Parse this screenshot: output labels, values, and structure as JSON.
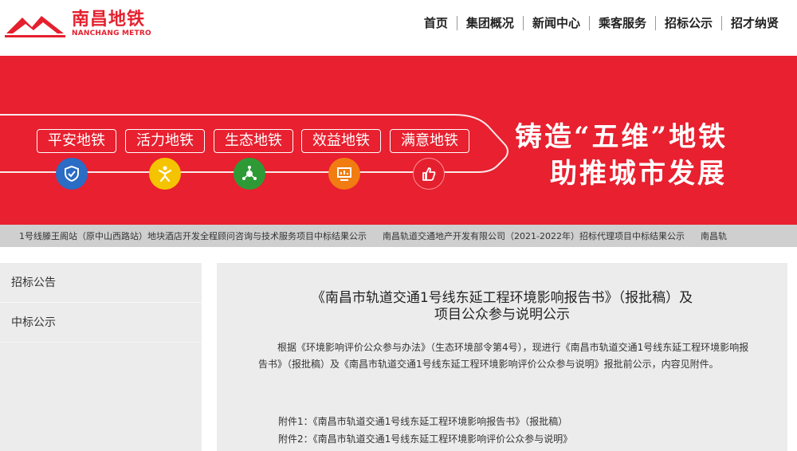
{
  "header": {
    "logo_cn": "南昌地铁",
    "logo_en": "NANCHANG METRO",
    "nav": [
      "首页",
      "集团概况",
      "新闻中心",
      "乘客服务",
      "招标公示",
      "招才纳贤"
    ]
  },
  "banner": {
    "pills": [
      "平安地铁",
      "活力地铁",
      "生态地铁",
      "效益地铁",
      "满意地铁"
    ],
    "icons": [
      {
        "name": "shield-check-icon",
        "color": "#2b6cc4"
      },
      {
        "name": "person-vitality-icon",
        "color": "#f5c400"
      },
      {
        "name": "eco-network-icon",
        "color": "#2e9a36"
      },
      {
        "name": "monitor-chart-icon",
        "color": "#f07c12"
      },
      {
        "name": "thumbs-up-icon",
        "color": "#e5202e"
      }
    ],
    "slogan_line1": "铸造“五维”地铁",
    "slogan_line2": "助推城市发展"
  },
  "ticker": [
    "1号线滕王阁站（原中山西路站）地块酒店开发全程顾问咨询与技术服务项目中标结果公示",
    "南昌轨道交通地产开发有限公司（2021-2022年）招标代理项目中标结果公示",
    "南昌轨"
  ],
  "sidebar": [
    "招标公告",
    "中标公示"
  ],
  "article": {
    "title_line1": "《南昌市轨道交通1号线东延工程环境影响报告书》（报批稿）及",
    "title_line2": "项目公众参与说明公示",
    "paragraph": "根据《环境影响评价公众参与办法》（生态环境部令第4号），现进行《南昌市轨道交通1号线东延工程环境影响报告书》（报批稿）及《南昌市轨道交通1号线东延工程环境影响评价公众参与说明》报批前公示，内容见附件。",
    "attachments": [
      "附件1：《南昌市轨道交通1号线东延工程环境影响报告书》（报批稿）",
      "附件2：《南昌市轨道交通1号线东延工程环境影响评价公众参与说明》"
    ]
  },
  "colors": {
    "brand_red": "#e5202e",
    "banner_red": "#e8202f",
    "ticker_gray": "#cfcfcf",
    "panel_gray": "#ececec"
  }
}
